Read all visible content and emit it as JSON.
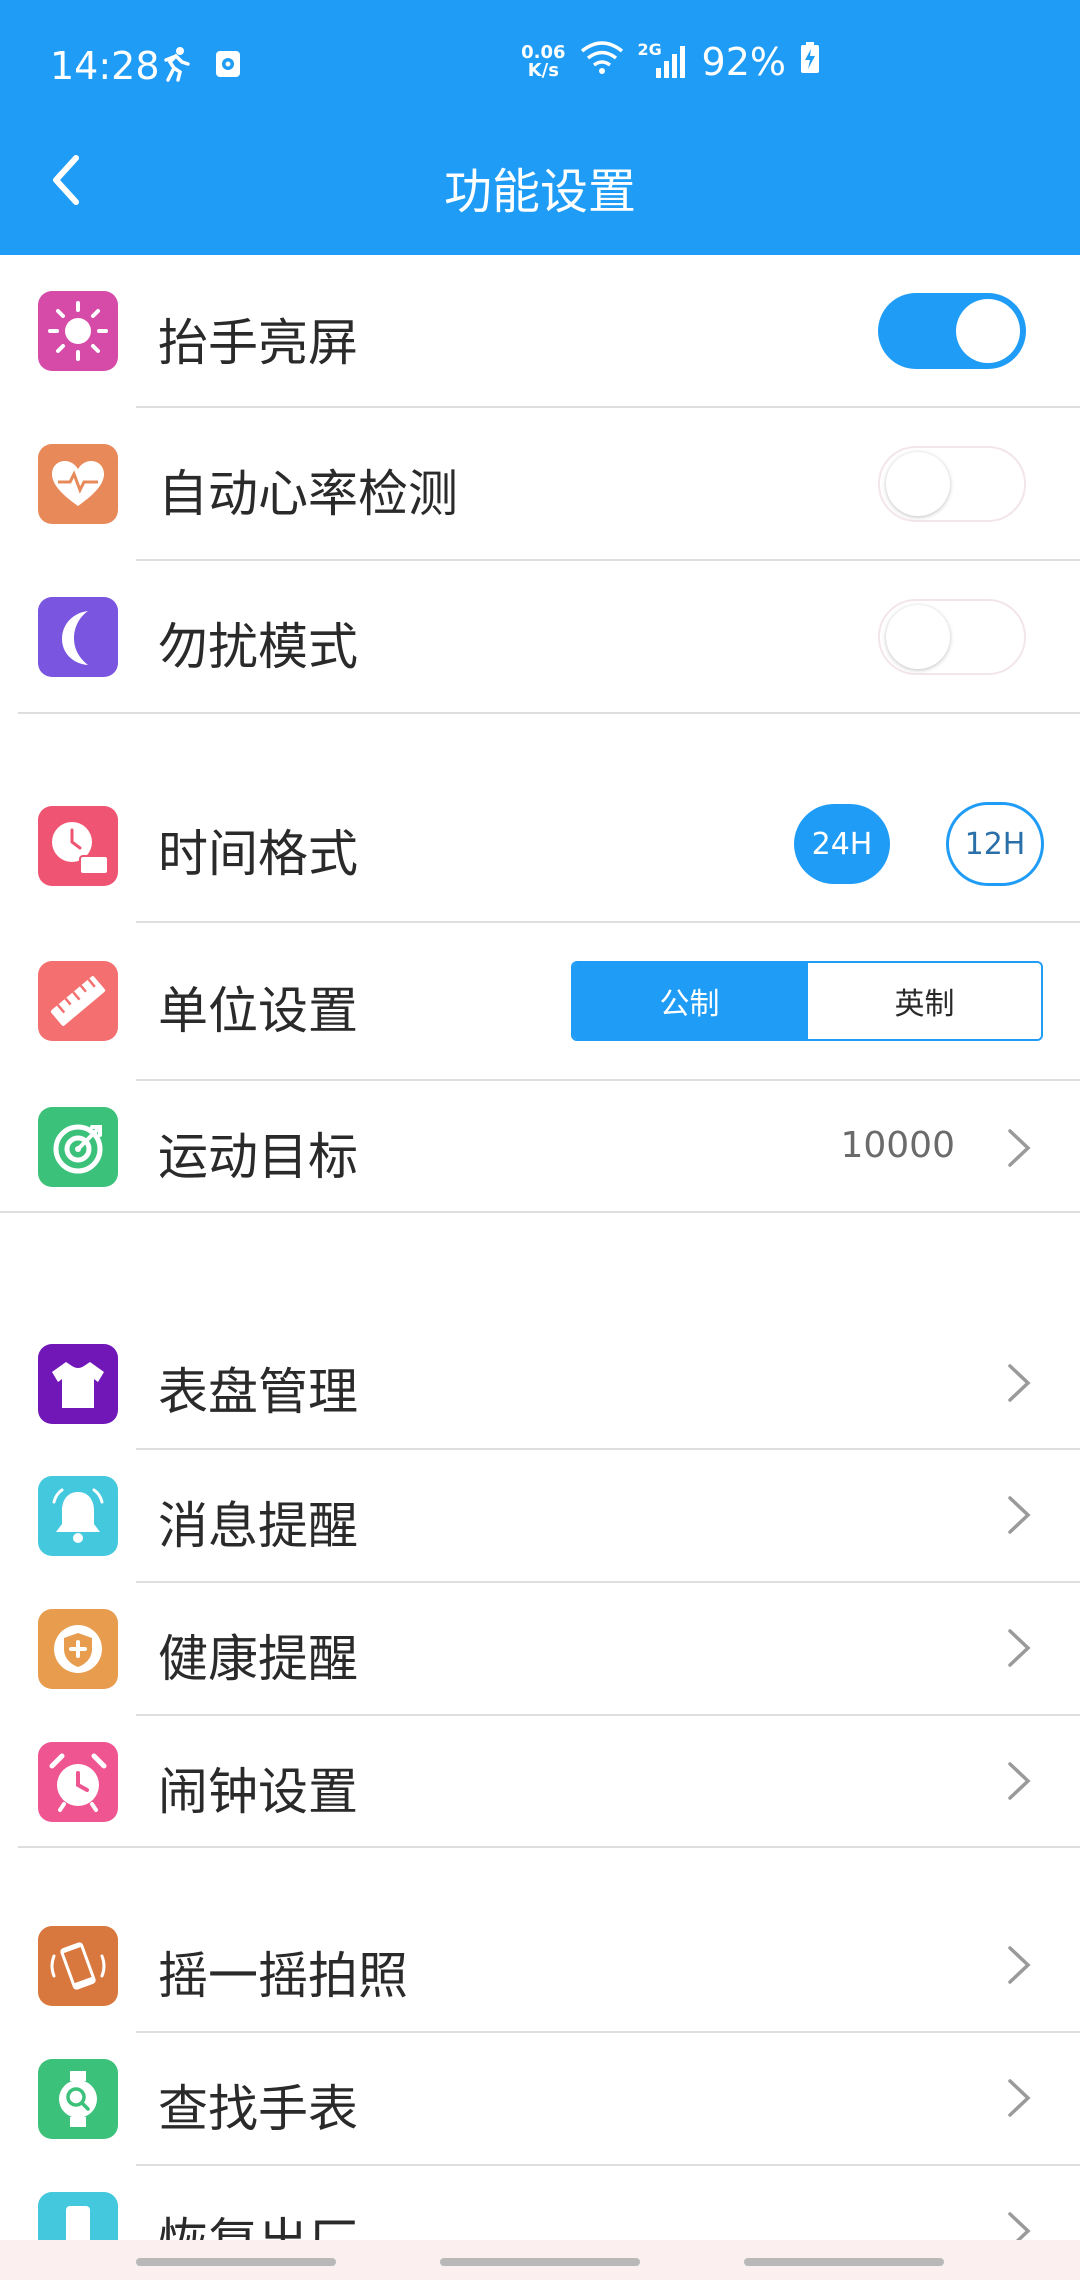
{
  "status": {
    "time": "14:28",
    "netspeed_top": "0.06",
    "netspeed_bottom": "K/s",
    "network": "2G",
    "battery": "92%"
  },
  "header": {
    "title": "功能设置"
  },
  "rows": [
    {
      "label": "抬手亮屏",
      "icon": "sun-icon",
      "color": "#d64aa8",
      "toggle": true
    },
    {
      "label": "自动心率检测",
      "icon": "heart-rate-icon",
      "color": "#e8895a",
      "toggle": false
    },
    {
      "label": "勿扰模式",
      "icon": "moon-icon",
      "color": "#7a55e0",
      "toggle": false
    },
    {
      "label": "时间格式",
      "icon": "clock-24h-icon",
      "color": "#ef5573",
      "options": [
        "24H",
        "12H"
      ],
      "selected": "24H"
    },
    {
      "label": "单位设置",
      "icon": "ruler-icon",
      "color": "#f46f6f",
      "options": [
        "公制",
        "英制"
      ],
      "selected": "公制"
    },
    {
      "label": "运动目标",
      "icon": "target-icon",
      "color": "#3cc17a",
      "value": "10000"
    },
    {
      "label": "表盘管理",
      "icon": "shirt-icon",
      "color": "#7217b7"
    },
    {
      "label": "消息提醒",
      "icon": "bell-icon",
      "color": "#43c8dd"
    },
    {
      "label": "健康提醒",
      "icon": "health-shield-icon",
      "color": "#e89c4e"
    },
    {
      "label": "闹钟设置",
      "icon": "alarm-clock-icon",
      "color": "#ef5590"
    },
    {
      "label": "摇一摇拍照",
      "icon": "shake-phone-icon",
      "color": "#d9783e"
    },
    {
      "label": "查找手表",
      "icon": "watch-search-icon",
      "color": "#3cc17a"
    },
    {
      "label": "恢复出厂",
      "icon": "phone-reset-icon",
      "color": "#43c8dd"
    }
  ]
}
